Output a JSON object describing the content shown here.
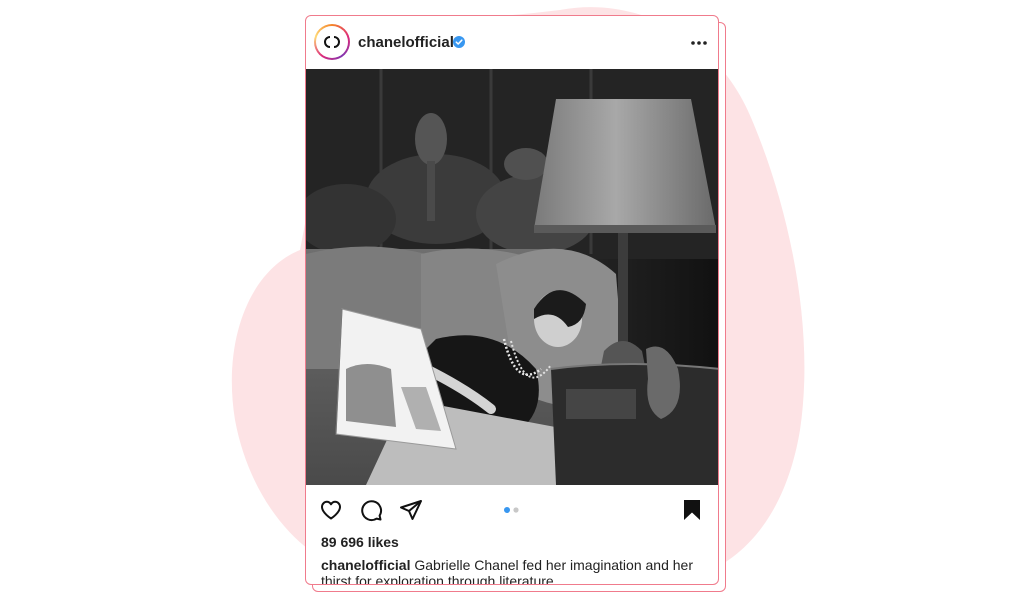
{
  "post": {
    "username": "chanelofficial",
    "verified": true,
    "likes_text": "89 696 likes",
    "caption_user": "chanelofficial",
    "caption_text": " Gabrielle Chanel fed her imagination and her thirst for exploration through literature.",
    "carousel": {
      "total": 2,
      "active": 1
    }
  },
  "icons": {
    "logo": "chanel-logo-icon",
    "verified": "verified-badge-icon",
    "more": "more-options-icon",
    "like": "heart-icon",
    "comment": "comment-icon",
    "share": "share-icon",
    "save": "bookmark-icon"
  },
  "colors": {
    "blob": "#fde3e5",
    "card_border": "#f07b8c",
    "verified": "#3897f0",
    "text": "#222222",
    "carousel_active": "#3897f0",
    "carousel_inactive": "#c8c8c8"
  }
}
